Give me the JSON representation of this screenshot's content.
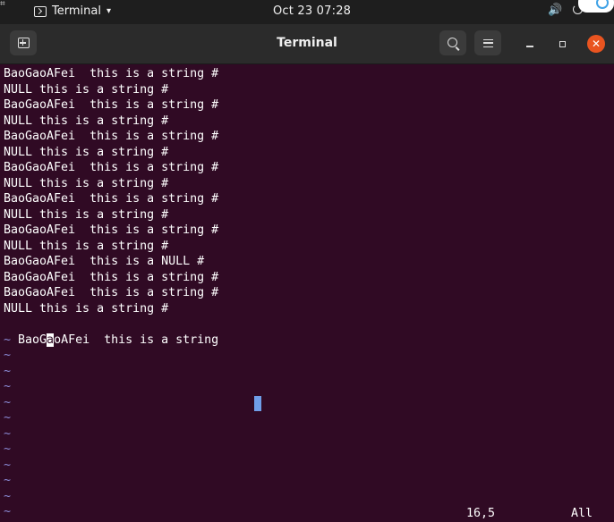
{
  "topbar": {
    "app_name": "Terminal",
    "caret": "▾",
    "clock": "Oct 23  07:28",
    "volume_icon": "🔊"
  },
  "window": {
    "title": "Terminal",
    "close_glyph": "✕"
  },
  "editor": {
    "lines": [
      "BaoGaoAFei  this is a string #",
      "NULL this is a string #",
      "BaoGaoAFei  this is a string #",
      "NULL this is a string #",
      "BaoGaoAFei  this is a string #",
      "NULL this is a string #",
      "BaoGaoAFei  this is a string #",
      "NULL this is a string #",
      "BaoGaoAFei  this is a string #",
      "NULL this is a string #",
      "BaoGaoAFei  this is a string #",
      "NULL this is a string #",
      "BaoGaoAFei  this is a NULL #",
      "BaoGaoAFei  this is a string #",
      "BaoGaoAFei  this is a string #",
      "NULL this is a string #"
    ],
    "cursor_line": {
      "before": "BaoG",
      "cursor_char": "a",
      "after": "oAFei  this is a string"
    },
    "tilde": "~",
    "tilde_count": 12,
    "status": {
      "position": "16,5",
      "scope": "All"
    }
  }
}
